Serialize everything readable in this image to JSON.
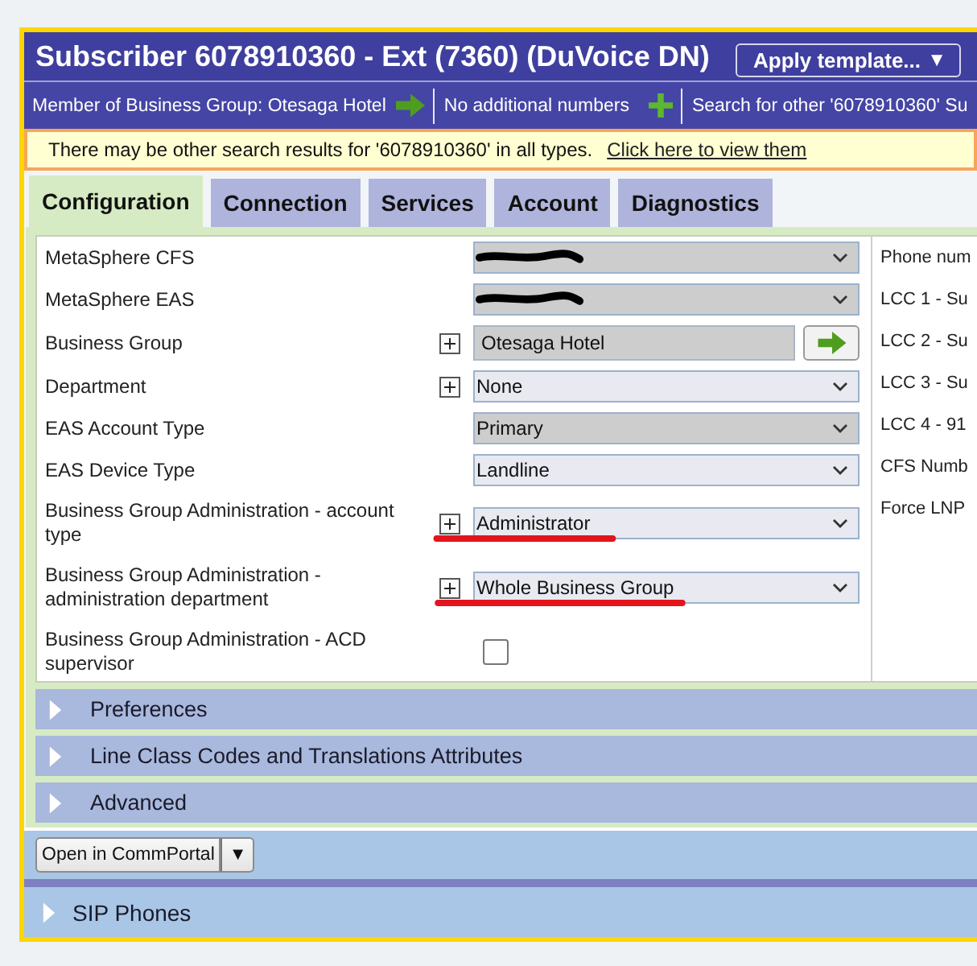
{
  "header": {
    "title": "Subscriber 6078910360 - Ext (7360) (DuVoice DN)",
    "template_button": {
      "label": "Apply template...",
      "caret": "▼"
    }
  },
  "info_bar": [
    {
      "kind": "arrow",
      "text": "Member of Business Group: Otesaga Hotel"
    },
    {
      "kind": "add",
      "text": "No additional numbers"
    },
    {
      "kind": "plain",
      "text": "Search for other '6078910360' Su"
    }
  ],
  "notice": {
    "text": "There may be other search results for '6078910360' in all types.",
    "link": "Click here to view them"
  },
  "tabs": [
    {
      "label": "Configuration",
      "selected": true
    },
    {
      "label": "Connection",
      "selected": false
    },
    {
      "label": "Services",
      "selected": false
    },
    {
      "label": "Account",
      "selected": false
    },
    {
      "label": "Diagnostics",
      "selected": false
    }
  ],
  "form": {
    "fields": [
      {
        "kind": "select",
        "label": "MetaSphere CFS",
        "redacted": true,
        "disabled": true,
        "add_button": false,
        "underlined": false
      },
      {
        "kind": "select",
        "label": "MetaSphere EAS",
        "redacted": true,
        "disabled": true,
        "add_button": false,
        "underlined": false
      },
      {
        "kind": "text-go",
        "label": "Business Group",
        "value": "Otesaga Hotel",
        "redacted": false,
        "disabled": true,
        "add_button": true,
        "underlined": false
      },
      {
        "kind": "select",
        "label": "Department",
        "value": "None",
        "redacted": false,
        "disabled": false,
        "add_button": true,
        "underlined": false
      },
      {
        "kind": "select",
        "label": "EAS Account Type",
        "value": "Primary",
        "redacted": false,
        "disabled": true,
        "add_button": false,
        "underlined": false
      },
      {
        "kind": "select",
        "label": "EAS Device Type",
        "value": "Landline",
        "redacted": false,
        "disabled": false,
        "add_button": false,
        "underlined": false
      },
      {
        "kind": "select",
        "label": "Business Group Administration - account type",
        "value": "Administrator",
        "redacted": false,
        "disabled": false,
        "add_button": true,
        "underlined": true
      },
      {
        "kind": "select",
        "label": "Business Group Administration - administration department",
        "value": "Whole Business Group",
        "redacted": false,
        "disabled": false,
        "add_button": true,
        "underlined": true
      },
      {
        "kind": "checkbox",
        "label": "Business Group Administration - ACD supervisor",
        "checked": false,
        "redacted": false,
        "disabled": false,
        "add_button": false,
        "underlined": false
      }
    ],
    "side_labels": [
      "Phone num",
      "LCC 1 - Su",
      "LCC 2 - Su",
      "LCC 3 - Su",
      "LCC 4 - 91",
      "CFS Numb",
      "Force LNP"
    ]
  },
  "sections": [
    {
      "label": "Preferences",
      "expanded": false
    },
    {
      "label": "Line Class Codes and Translations Attributes",
      "expanded": false
    },
    {
      "label": "Advanced",
      "expanded": false
    }
  ],
  "actions": {
    "button": "Open in CommPortal",
    "caret": "▼"
  },
  "sip_section": {
    "label": "SIP Phones",
    "expanded": false
  }
}
